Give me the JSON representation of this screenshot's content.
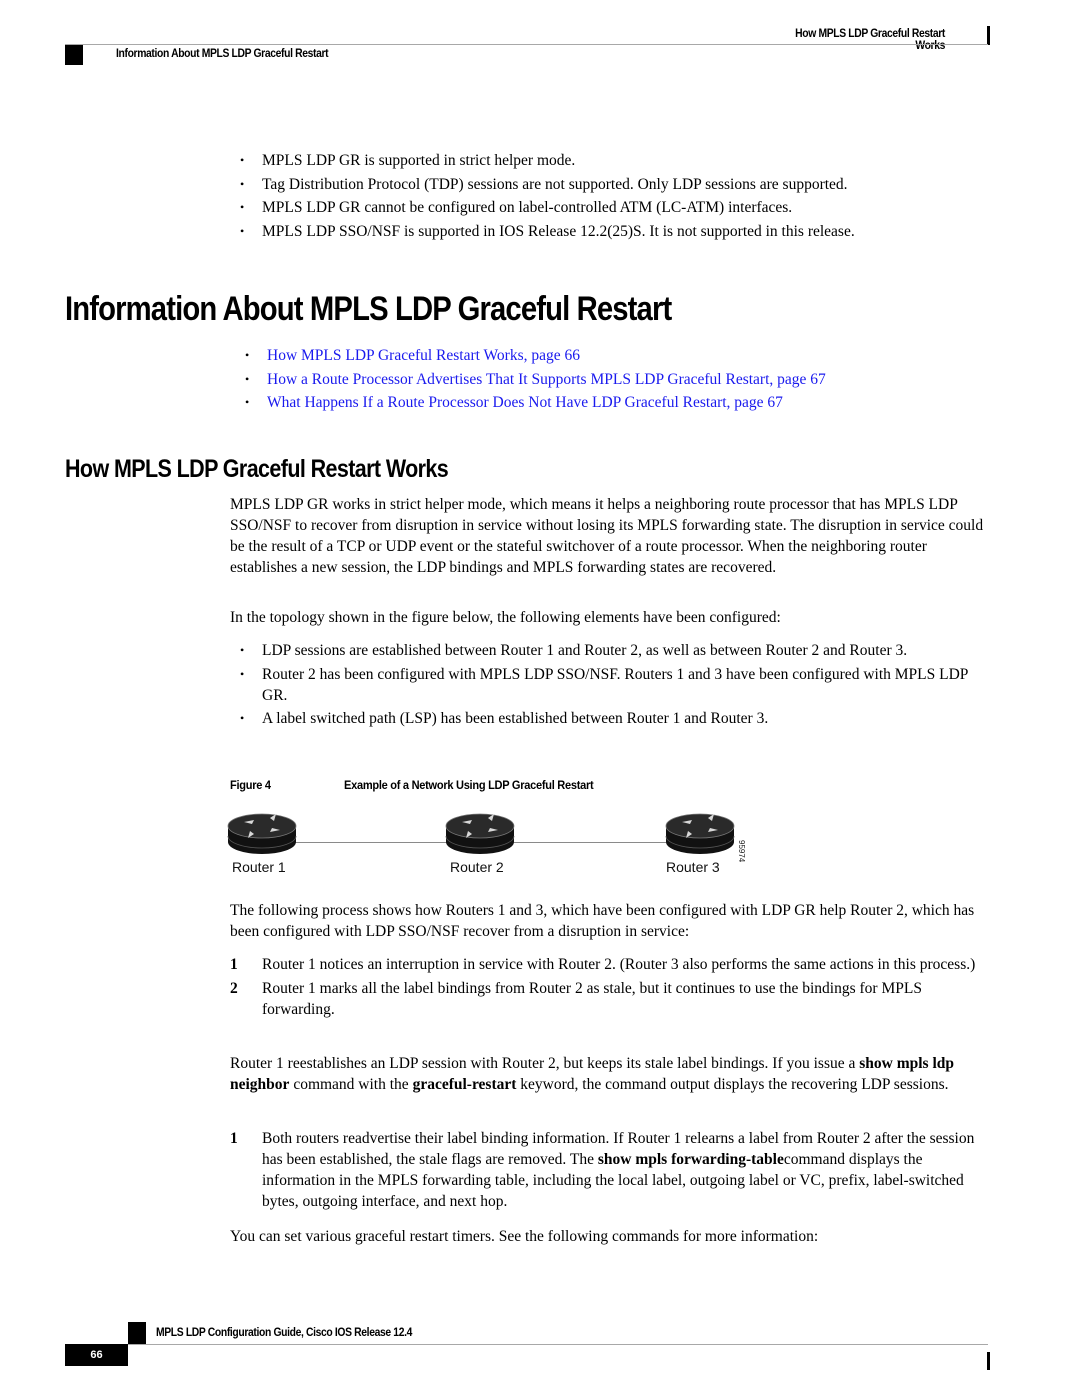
{
  "header": {
    "right_title": "How MPLS LDP Graceful Restart Works",
    "left_title": "Information About MPLS LDP Graceful Restart"
  },
  "intro_bullets": [
    "MPLS LDP GR is supported in strict helper mode.",
    "Tag Distribution Protocol (TDP) sessions are not supported. Only LDP sessions are supported.",
    "MPLS LDP GR cannot be configured on label-controlled ATM (LC-ATM) interfaces.",
    "MPLS LDP SSO/NSF is supported in IOS Release 12.2(25)S. It is not supported in this release."
  ],
  "section1": {
    "title": "Information About MPLS LDP Graceful Restart",
    "links": [
      "How MPLS LDP Graceful Restart Works,  page 66",
      "How a Route Processor Advertises That It Supports MPLS LDP Graceful Restart,  page 67",
      "What Happens If a Route Processor Does Not Have LDP Graceful Restart,  page 67"
    ]
  },
  "section2": {
    "title": "How MPLS LDP Graceful Restart Works",
    "para1": "MPLS LDP GR works in strict helper mode, which means it helps a neighboring route processor that has MPLS LDP SSO/NSF to recover from disruption in service without losing its MPLS forwarding state. The disruption in service could be the result of a TCP or UDP event or the stateful switchover of a route processor. When the neighboring router establishes a new session, the LDP bindings and MPLS forwarding states are recovered.",
    "para2": "In the topology shown in the figure below, the following elements have been configured:",
    "config_bullets": [
      "LDP sessions are established between Router 1 and Router 2, as well as between Router 2 and Router 3.",
      "Router 2 has been configured with MPLS LDP SSO/NSF. Routers 1 and 3 have been configured with MPLS LDP GR.",
      "A label switched path (LSP) has been established between Router 1 and Router 3."
    ],
    "figure": {
      "label": "Figure 4",
      "title": "Example of a Network Using LDP Graceful Restart",
      "routers": [
        "Router 1",
        "Router 2",
        "Router 3"
      ],
      "figure_id": "95974"
    },
    "para3": "The following process shows how Routers 1 and 3, which have been configured with LDP GR help Router 2, which has been configured with LDP SSO/NSF recover from a disruption in service:",
    "steps1": [
      {
        "num": "1",
        "text": "Router 1 notices an interruption in service with Router 2. (Router 3 also performs the same actions in this process.)"
      },
      {
        "num": "2",
        "text": "Router 1 marks all the label bindings from Router 2 as stale, but it continues to use the bindings for MPLS forwarding."
      }
    ],
    "para4": {
      "t1": "Router 1 reestablishes an LDP session with Router 2, but keeps its stale label bindings. If you issue a ",
      "b1": "show mpls ldp neighbor",
      "t2": " command with the ",
      "b2": "graceful-restart",
      "t3": " keyword, the command output displays the recovering LDP sessions."
    },
    "steps2": [
      {
        "num": "1",
        "t1": "Both routers readvertise their label binding information. If Router 1 relearns a label from Router 2 after the session has been established, the stale flags are removed. The ",
        "b1": "show mpls forwarding-table",
        "t2": "command displays the information in the MPLS forwarding table, including the local label, outgoing label or VC, prefix, label-switched bytes, outgoing interface, and next hop."
      }
    ],
    "para5": "You can set various graceful restart timers. See the following commands for more information:"
  },
  "footer": {
    "guide_title": "MPLS LDP Configuration Guide, Cisco IOS Release 12.4",
    "page_number": "66"
  }
}
